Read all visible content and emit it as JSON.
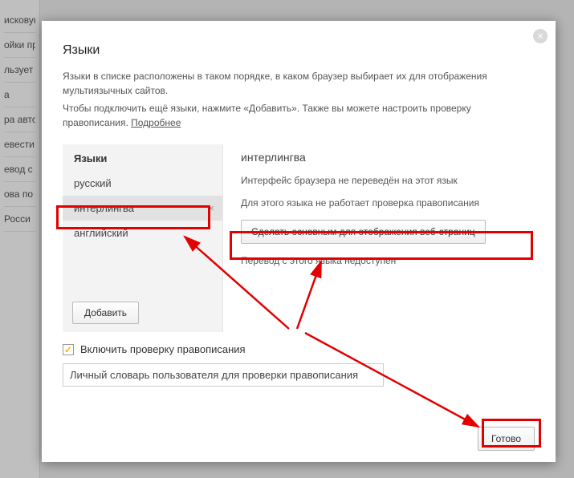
{
  "bg": {
    "items": [
      "исковую",
      "ойки пр",
      "льзует д",
      "а",
      "ра авток",
      "евести",
      "евод с",
      "ова по",
      "Росси"
    ]
  },
  "dialog": {
    "title": "Языки",
    "desc1": "Языки в списке расположены в таком порядке, в каком браузер выбирает их для отображения мультиязычных сайтов.",
    "desc2_prefix": "Чтобы подключить ещё языки, нажмите «Добавить». Также вы можете настроить проверку правописания. ",
    "desc2_link": "Подробнее",
    "close_x": "×"
  },
  "langs": {
    "header": "Языки",
    "items": [
      {
        "label": "русский"
      },
      {
        "label": "интерлингва",
        "selected": true
      },
      {
        "label": "английский"
      }
    ],
    "remove_x": "×",
    "add_label": "Добавить"
  },
  "detail": {
    "title": "интерлингва",
    "line1": "Интерфейс браузера не переведён на этот язык",
    "line2": "Для этого языка не работает проверка правописания",
    "primary_btn": "Сделать основным для отображения веб-страниц",
    "line3": "Перевод с этого языка недоступен"
  },
  "spellcheck": {
    "checkbox_label": "Включить проверку правописания",
    "dict_label": "Личный словарь пользователя для проверки правописания"
  },
  "done": {
    "label": "Готово"
  }
}
